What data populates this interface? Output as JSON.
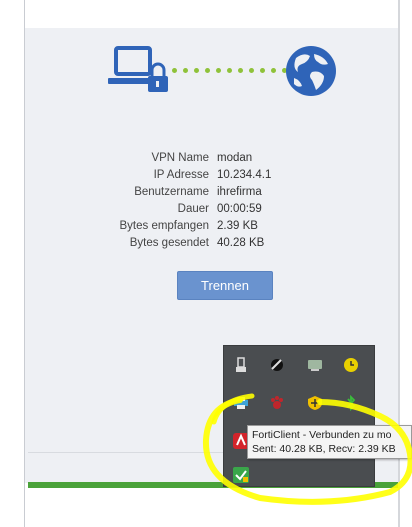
{
  "vpn": {
    "rows": [
      {
        "label": "VPN Name",
        "value": "modan"
      },
      {
        "label": "IP Adresse",
        "value": "10.234.4.1"
      },
      {
        "label": "Benutzername",
        "value": "ihrefirma"
      },
      {
        "label": "Dauer",
        "value": "00:00:59"
      },
      {
        "label": "Bytes empfangen",
        "value": "2.39 KB"
      },
      {
        "label": "Bytes gesendet",
        "value": "40.28 KB"
      }
    ],
    "disconnect_label": "Trennen"
  },
  "tooltip": {
    "line1": "FortiClient - Verbunden zu mo",
    "line2": "Sent: 40.28 KB, Recv: 2.39 KB"
  },
  "tray_icons": [
    "usb-icon",
    "satellite-icon",
    "network-icon",
    "clock-icon",
    "printer-icon",
    "paw-icon",
    "shield-icon",
    "bluetooth-icon",
    "avira-icon",
    "forticlient-icon"
  ],
  "colors": {
    "accent": "#6a93cf",
    "link_dots": "#8fc23a",
    "icon_blue": "#2f64b8",
    "highlight": "#ffff00",
    "status_bar": "#4aa23a"
  }
}
